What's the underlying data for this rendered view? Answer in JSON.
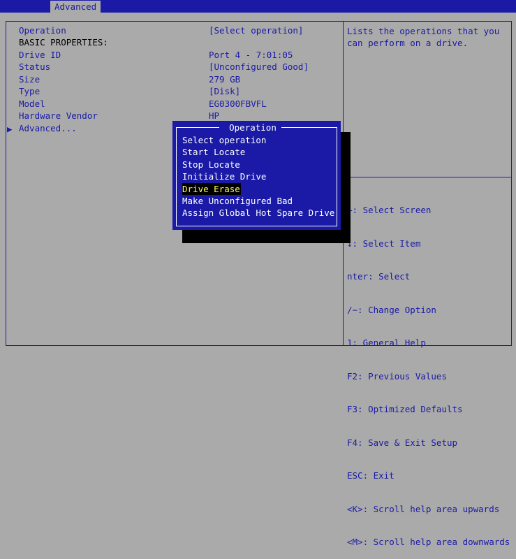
{
  "colors": {
    "bg": "#aaaaaa",
    "accent": "#1a1aa6",
    "highlight": "#ffff55"
  },
  "tabs": [
    {
      "label": "Advanced"
    }
  ],
  "properties": {
    "operation_label": "Operation",
    "operation_value": "[Select operation]",
    "section_label": "BASIC PROPERTIES:",
    "rows": [
      {
        "label": "Drive ID",
        "value": "Port 4 - 7:01:05"
      },
      {
        "label": "Status",
        "value": "[Unconfigured Good]"
      },
      {
        "label": "Size",
        "value": "279 GB"
      },
      {
        "label": "Type",
        "value": "[Disk]"
      },
      {
        "label": "Model",
        "value": "EG0300FBVFL"
      },
      {
        "label": "Hardware Vendor",
        "value": "HP"
      }
    ],
    "advanced_label": "Advanced..."
  },
  "help": {
    "description": "Lists the operations that you\ncan perform on a drive.",
    "keys": [
      "←: Select Screen",
      "↓: Select Item",
      "nter: Select",
      "/−: Change Option",
      "1: General Help",
      "F2: Previous Values",
      "F3: Optimized Defaults",
      "F4: Save & Exit Setup",
      "ESC: Exit",
      "<K>: Scroll help area upwards",
      "<M>: Scroll help area downwards"
    ]
  },
  "popup": {
    "title": "Operation",
    "items": [
      "Select operation",
      "Start Locate",
      "Stop Locate",
      "Initialize Drive",
      "Drive Erase",
      "Make Unconfigured Bad",
      "Assign Global Hot Spare Drive"
    ],
    "selected": "Drive Erase"
  },
  "icons": {
    "submenu": "triangle-right-icon"
  }
}
